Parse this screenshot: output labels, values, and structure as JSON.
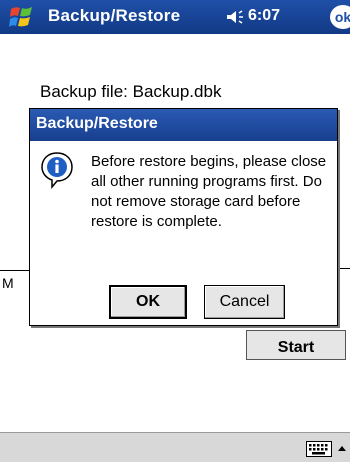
{
  "titlebar": {
    "title": "Backup/Restore",
    "time": "6:07",
    "ok_label": "ok",
    "start_icon": "windows-flag-icon",
    "volume_icon": "speaker-icon"
  },
  "background": {
    "backup_file_label": "Backup file: Backup.dbk",
    "partial_letter": "M",
    "start_button_label": "Start"
  },
  "dialog": {
    "title": "Backup/Restore",
    "icon": "info-icon",
    "message": "Before restore begins, please close all other running programs first. Do not remove storage card before restore is complete.",
    "ok_label": "OK",
    "cancel_label": "Cancel"
  },
  "bottombar": {
    "input_icon": "keyboard-icon"
  },
  "colors": {
    "titlebar": "#1f4fa8",
    "dialog_titlebar": "#2a5ab3",
    "button_face": "#e6e6e6",
    "bottombar": "#d8d8d8"
  }
}
